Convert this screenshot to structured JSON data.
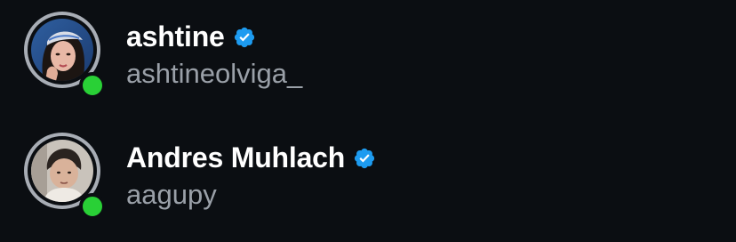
{
  "users": [
    {
      "display_name": "ashtine",
      "username": "ashtineolviga_",
      "verified": true,
      "online": true,
      "avatar": "profile-photo-woman-bandana"
    },
    {
      "display_name": "Andres Muhlach",
      "username": "aagupy",
      "verified": true,
      "online": true,
      "avatar": "profile-photo-boy"
    }
  ],
  "colors": {
    "background": "#0b0e12",
    "name": "#ffffff",
    "username": "#9aa0a8",
    "verified_badge": "#1d9bf0",
    "online_dot": "#29d036",
    "avatar_ring": "#a8adb5"
  },
  "icons": {
    "verified": "verified-badge-icon",
    "online": "online-status-icon"
  }
}
